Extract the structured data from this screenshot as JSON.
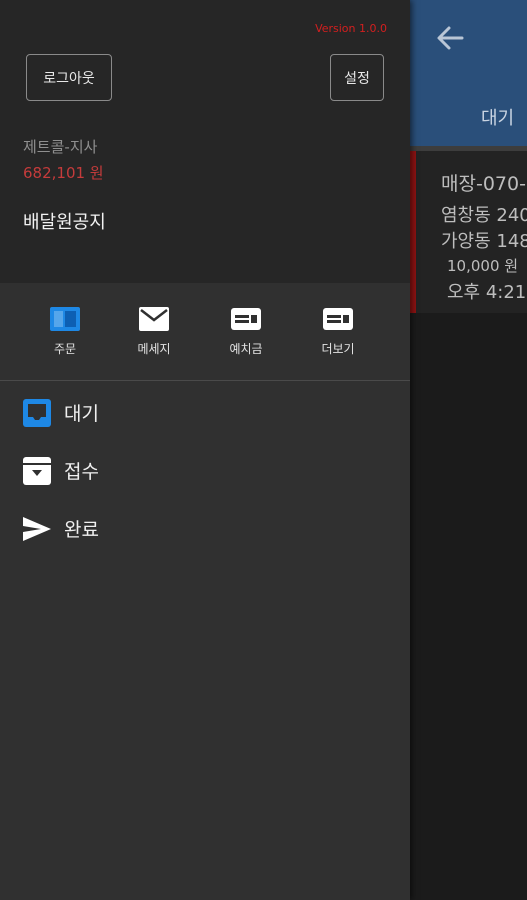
{
  "drawer": {
    "version": "Version 1.0.0",
    "logout_label": "로그아웃",
    "settings_label": "설정",
    "branch_name": "제트콜-지사",
    "balance": "682,101 원",
    "notice_label": "배달원공지",
    "quick_actions": [
      {
        "label": "주문",
        "icon": "order-icon",
        "color": "#1e88e5"
      },
      {
        "label": "메세지",
        "icon": "envelope-icon",
        "color": "#ffffff"
      },
      {
        "label": "예치금",
        "icon": "card-icon",
        "color": "#ffffff"
      },
      {
        "label": "더보기",
        "icon": "card-icon",
        "color": "#ffffff"
      }
    ],
    "menu": [
      {
        "label": "대기",
        "icon": "inbox-icon",
        "color": "#1e88e5"
      },
      {
        "label": "접수",
        "icon": "archive-icon",
        "color": "#ffffff"
      },
      {
        "label": "완료",
        "icon": "send-icon",
        "color": "#ffffff"
      }
    ]
  },
  "main": {
    "tab_label": "대기",
    "order": {
      "title": "매장-070-",
      "address1": "염창동 240",
      "address2": "가양동 148",
      "price": "10,000 원",
      "time": "오후 4:21"
    }
  },
  "colors": {
    "header_blue": "#2a4f7a",
    "accent_blue": "#1e88e5",
    "version_red": "#d41f1f",
    "balance_red": "#c53b3b",
    "card_marker": "#8f1313"
  }
}
